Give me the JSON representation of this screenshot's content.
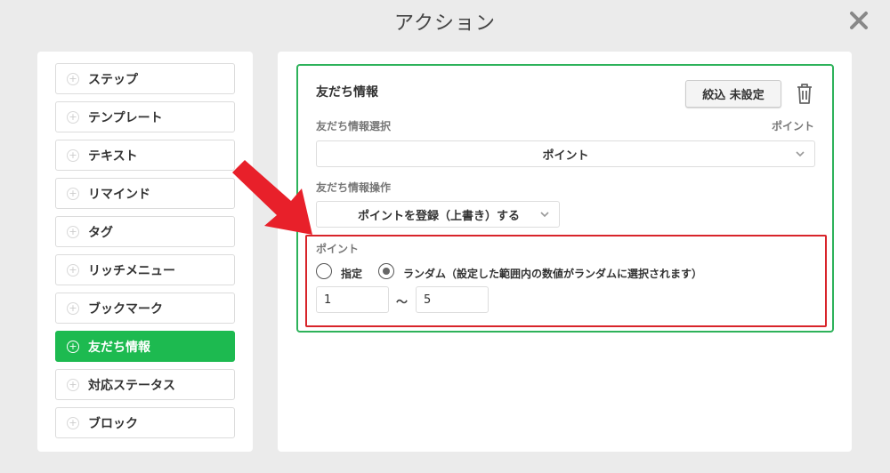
{
  "modal": {
    "title": "アクション"
  },
  "sidebar": {
    "items": [
      {
        "label": "ステップ",
        "active": false
      },
      {
        "label": "テンプレート",
        "active": false
      },
      {
        "label": "テキスト",
        "active": false
      },
      {
        "label": "リマインド",
        "active": false
      },
      {
        "label": "タグ",
        "active": false
      },
      {
        "label": "リッチメニュー",
        "active": false
      },
      {
        "label": "ブックマーク",
        "active": false
      },
      {
        "label": "友だち情報",
        "active": true
      },
      {
        "label": "対応ステータス",
        "active": false
      },
      {
        "label": "ブロック",
        "active": false
      }
    ]
  },
  "card": {
    "title": "友だち情報",
    "filter_button": "絞込 未設定",
    "select_label": "友だち情報選択",
    "select_right_label": "ポイント",
    "select_value": "ポイント",
    "operation_label": "友だち情報操作",
    "operation_value": "ポイントを登録（上書き）する",
    "points": {
      "label": "ポイント",
      "option_fixed": "指定",
      "option_random": "ランダム（設定した範囲内の数値がランダムに選択されます）",
      "selected": "random",
      "min": "1",
      "tilde": "～",
      "max": "5"
    }
  },
  "colors": {
    "accent_green": "#1dba50",
    "highlight_red": "#d8242a",
    "arrow_red": "#e8202a"
  },
  "icons": {
    "close": "close-icon",
    "trash": "trash-icon",
    "plus": "plus-circle-icon",
    "chevron": "chevron-down-icon",
    "arrow": "pointer-arrow-icon"
  }
}
